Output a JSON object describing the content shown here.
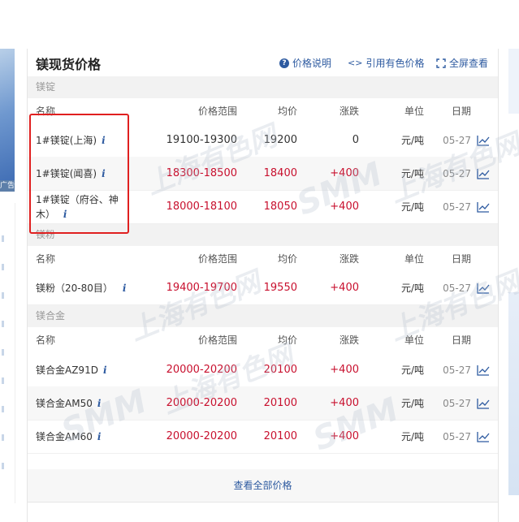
{
  "header": {
    "title": "镁现货价格",
    "links": {
      "explain": "价格说明",
      "cite": "引用有色价格",
      "fullscreen": "全屏查看"
    }
  },
  "columns": {
    "name": "名称",
    "range": "价格范围",
    "avg": "均价",
    "change": "涨跌",
    "unit": "单位",
    "date": "日期"
  },
  "sections": [
    {
      "label": "镁锭",
      "rows": [
        {
          "name": "1#镁锭(上海)",
          "range": "19100-19300",
          "avg": "19200",
          "change": "0",
          "unit": "元/吨",
          "date": "05-27",
          "trend": "flat"
        },
        {
          "name": "1#镁锭(闻喜)",
          "range": "18300-18500",
          "avg": "18400",
          "change": "+400",
          "unit": "元/吨",
          "date": "05-27",
          "trend": "up"
        },
        {
          "name": "1#镁锭（府谷、神木）",
          "range": "18000-18100",
          "avg": "18050",
          "change": "+400",
          "unit": "元/吨",
          "date": "05-27",
          "trend": "up"
        }
      ]
    },
    {
      "label": "镁粉",
      "rows": [
        {
          "name": "镁粉（20-80目）",
          "range": "19400-19700",
          "avg": "19550",
          "change": "+400",
          "unit": "元/吨",
          "date": "05-27",
          "trend": "up"
        }
      ]
    },
    {
      "label": "镁合金",
      "rows": [
        {
          "name": "镁合金AZ91D",
          "range": "20000-20200",
          "avg": "20100",
          "change": "+400",
          "unit": "元/吨",
          "date": "05-27",
          "trend": "up"
        },
        {
          "name": "镁合金AM50",
          "range": "20000-20200",
          "avg": "20100",
          "change": "+400",
          "unit": "元/吨",
          "date": "05-27",
          "trend": "up"
        },
        {
          "name": "镁合金AM60",
          "range": "20000-20200",
          "avg": "20100",
          "change": "+400",
          "unit": "元/吨",
          "date": "05-27",
          "trend": "up"
        }
      ]
    }
  ],
  "footer": {
    "view_all": "查看全部价格"
  },
  "left_ad": {
    "tag": "广告"
  },
  "watermark": {
    "latin": "SMM",
    "cjk": "上海有色网"
  },
  "colors": {
    "accent": "#d0021b",
    "link": "#2d5aa0",
    "up": "#c8102e",
    "highlight": "#e02020"
  },
  "icons": {
    "info": "info-icon",
    "chart": "line-chart-icon",
    "help": "help-circle-icon",
    "code": "code-icon",
    "fullscreen": "fullscreen-icon"
  }
}
